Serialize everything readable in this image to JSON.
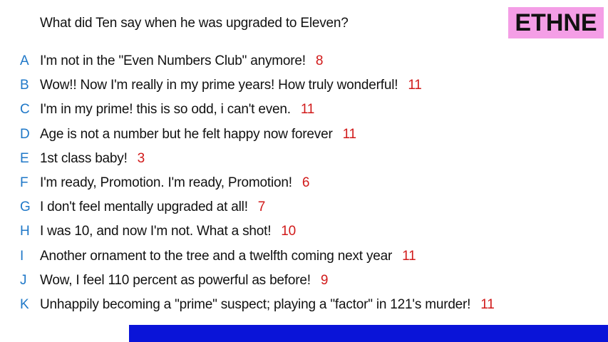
{
  "question": "What did Ten say when he was upgraded to Eleven?",
  "player_name": "ETHNE",
  "answers": [
    {
      "letter": "A",
      "text": "I'm not in the \"Even Numbers Club\" anymore!",
      "score": "8"
    },
    {
      "letter": "B",
      "text": "Wow!! Now I'm really in my prime years! How truly wonderful!",
      "score": "11"
    },
    {
      "letter": "C",
      "text": "I'm in my prime! this is so odd, i can't even.",
      "score": "11"
    },
    {
      "letter": "D",
      "text": "Age is not a number but he felt happy now forever",
      "score": "11"
    },
    {
      "letter": "E",
      "text": "1st class baby!",
      "score": "3"
    },
    {
      "letter": "F",
      "text": "I'm ready, Promotion. I'm ready, Promotion!",
      "score": "6"
    },
    {
      "letter": "G",
      "text": "I don't feel mentally upgraded at all!",
      "score": "7"
    },
    {
      "letter": "H",
      "text": "I was 10, and now I'm not. What a shot!",
      "score": "10"
    },
    {
      "letter": "I",
      "text": "Another ornament to the tree and a twelfth coming next year",
      "score": "11"
    },
    {
      "letter": "J",
      "text": "Wow, I feel 110 percent as powerful as before!",
      "score": "9"
    },
    {
      "letter": "K",
      "text": "Unhappily becoming a \"prime\" suspect; playing a \"factor\" in 121's murder!",
      "score": "11"
    }
  ],
  "colors": {
    "letter": "#1f78c8",
    "score": "#d11a1a",
    "badge_bg": "#f49ee6",
    "bottom_bar": "#0a14d8"
  }
}
